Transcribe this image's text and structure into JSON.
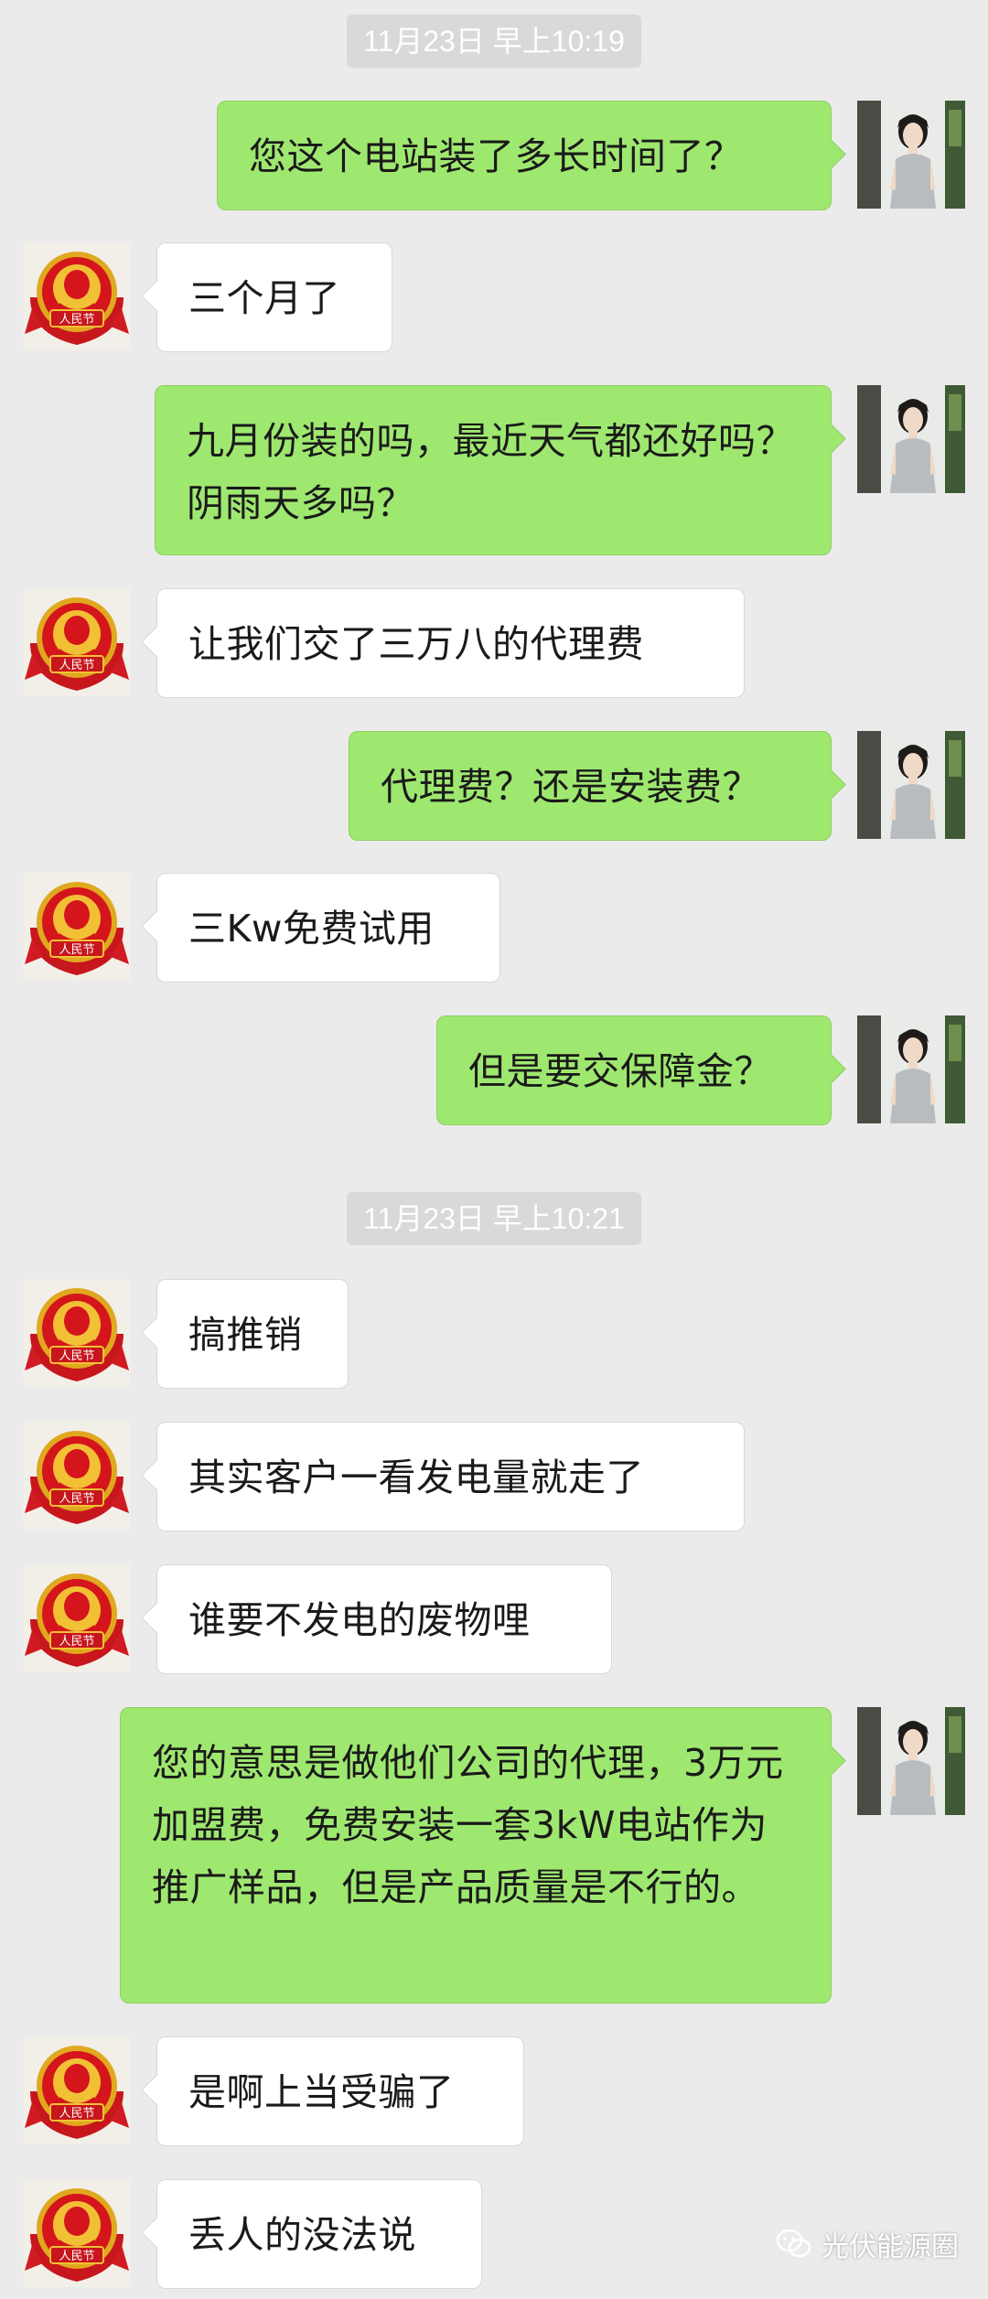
{
  "timestamps": [
    "11月23日 早上10:19",
    "11月23日 早上10:21"
  ],
  "messages": [
    {
      "side": "right",
      "text": "您这个电站装了多长时间了？"
    },
    {
      "side": "left",
      "text": "三个月了"
    },
    {
      "side": "right",
      "text": "九月份装的吗，最近天气都还好吗？阴雨天多吗？"
    },
    {
      "side": "left",
      "text": "让我们交了三万八的代理费"
    },
    {
      "side": "right",
      "text": "代理费？还是安装费？"
    },
    {
      "side": "left",
      "text": "三Kw免费试用"
    },
    {
      "side": "right",
      "text": "但是要交保障金？"
    },
    {
      "side": "left",
      "text": "搞推销"
    },
    {
      "side": "left",
      "text": "其实客户一看发电量就走了"
    },
    {
      "side": "left",
      "text": "谁要不发电的废物哩"
    },
    {
      "side": "right",
      "text": "您的意思是做他们公司的代理，3万元加盟费，免费安装一套3kW电站作为推广样品，但是产品质量是不行的。"
    },
    {
      "side": "left",
      "text": "是啊上当受骗了"
    },
    {
      "side": "left",
      "text": "丢人的没法说"
    }
  ],
  "avatars": {
    "left": {
      "icon": "emblem-avatar-icon",
      "label": "人民节"
    },
    "right": {
      "icon": "girl-photo-avatar-icon"
    }
  },
  "watermark": {
    "text": "光伏能源圈",
    "icon": "wechat-icon"
  },
  "colors": {
    "background": "#ebebeb",
    "sent_bubble": "#9fe870",
    "received_bubble": "#ffffff",
    "timestamp_bg": "#d9d9d9"
  }
}
